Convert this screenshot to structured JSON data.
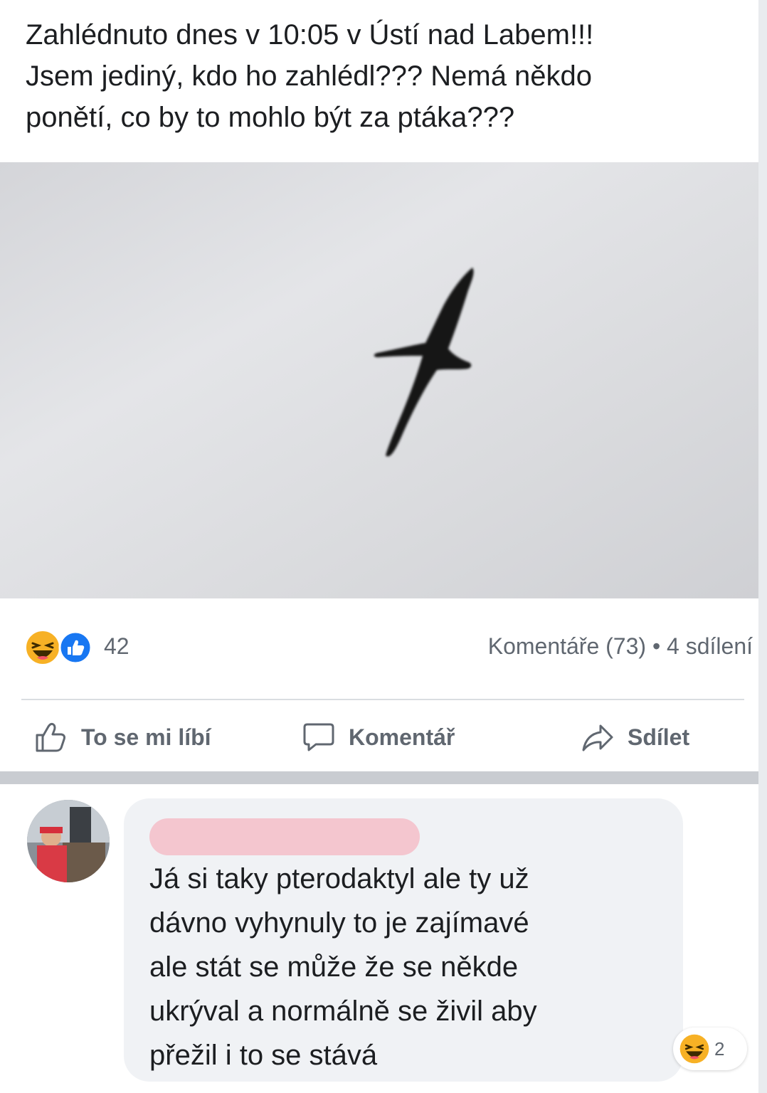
{
  "post": {
    "text_lines": [
      "Zahlédnuto dnes v 10:05 v Ústí nad Labem!!!",
      "Jsem jediný, kdo ho zahlédl??? Nemá někdo",
      "ponětí, co by to mohlo být za ptáka???"
    ],
    "reaction_icons": [
      "haha-icon",
      "like-icon"
    ],
    "reaction_count": "42",
    "comments_summary": "Komentáře (73) • 4 sdílení"
  },
  "actions": {
    "like_label": "To se mi líbí",
    "comment_label": "Komentář",
    "share_label": "Sdílet"
  },
  "comment": {
    "text_lines": [
      "Já si taky pterodaktyl ale ty už",
      "dávno vyhynuly to je zajímavé",
      "ale stát se může že se někde",
      "ukrýval a normálně se živil aby",
      "přežil i to se stává"
    ],
    "reaction_icon": "haha-icon",
    "reaction_count": "2"
  },
  "colors": {
    "text": "#1c1e21",
    "secondary": "#606770",
    "like_blue": "#1877f2",
    "haha_yellow": "#f7b125",
    "redaction_pink": "#f4c6cf",
    "bubble": "#f0f2f5"
  }
}
